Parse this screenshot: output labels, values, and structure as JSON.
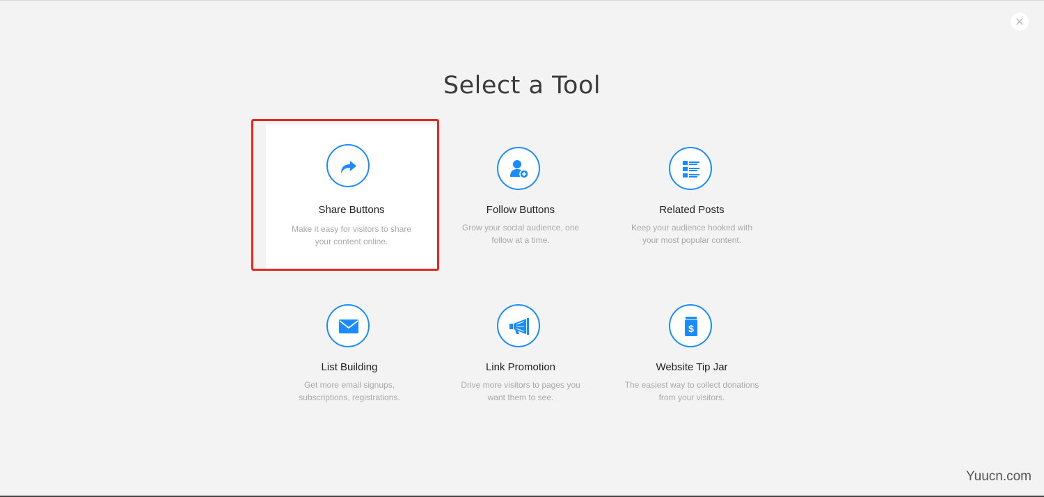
{
  "close": {
    "icon": "close-icon"
  },
  "title": "Select a Tool",
  "accent_color": "#1a8cff",
  "tools": [
    {
      "name": "Share Buttons",
      "description": [
        "Make it easy for visitors to share",
        "your content online."
      ],
      "icon": "share-arrow-icon",
      "selected": true
    },
    {
      "name": "Follow Buttons",
      "description": [
        "Grow your social audience, one",
        "follow at a time."
      ],
      "icon": "user-plus-icon",
      "selected": false
    },
    {
      "name": "Related Posts",
      "description": [
        "Keep your audience hooked with",
        "your most popular content."
      ],
      "icon": "list-icon",
      "selected": false
    },
    {
      "name": "List Building",
      "description": [
        "Get more email signups,",
        "subscriptions, registrations."
      ],
      "icon": "envelope-icon",
      "selected": false
    },
    {
      "name": "Link Promotion",
      "description": [
        "Drive more visitors to pages you",
        "want them to see."
      ],
      "icon": "megaphone-icon",
      "selected": false
    },
    {
      "name": "Website Tip Jar",
      "description": [
        "The easiest way to collect donations",
        "from your visitors."
      ],
      "icon": "tip-jar-icon",
      "selected": false
    }
  ],
  "highlight_color": "#e8261f",
  "watermark": "Yuucn.com"
}
